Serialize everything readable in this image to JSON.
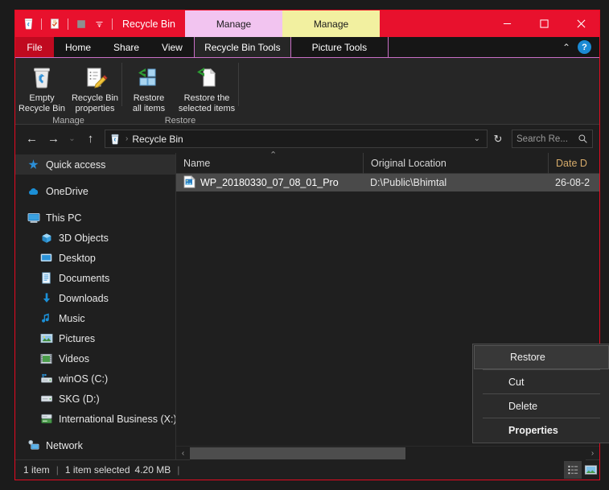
{
  "window": {
    "title": "Recycle Bin",
    "accent_color": "#e8112d",
    "quick_access": [
      {
        "name": "recycle-bin-icon",
        "label": "Recycle Bin"
      },
      {
        "name": "properties-icon",
        "label": "Properties"
      },
      {
        "name": "view-icon",
        "label": "View"
      },
      {
        "name": "customize-dropdown-icon",
        "label": "Customize Quick Access Toolbar"
      }
    ],
    "contextual_tabs": [
      {
        "label": "Manage",
        "group": "Recycle Bin Tools",
        "color": "#f2c4f0"
      },
      {
        "label": "Manage",
        "group": "Picture Tools",
        "color": "#f2f0a0"
      }
    ],
    "caption": {
      "minimize": "—",
      "maximize": "□",
      "close": "✕"
    }
  },
  "ribbon": {
    "tabs": [
      {
        "label": "File",
        "selected": false
      },
      {
        "label": "Home",
        "selected": false
      },
      {
        "label": "Share",
        "selected": false
      },
      {
        "label": "View",
        "selected": false
      },
      {
        "label": "Recycle Bin Tools",
        "selected": true
      },
      {
        "label": "Picture Tools",
        "selected": false
      }
    ],
    "collapse_label": "⌃",
    "help_label": "?",
    "groups": [
      {
        "title": "Manage",
        "buttons": [
          {
            "label_line1": "Empty",
            "label_line2": "Recycle Bin",
            "icon": "empty-recycle-bin-icon"
          },
          {
            "label_line1": "Recycle Bin",
            "label_line2": "properties",
            "icon": "recycle-bin-properties-icon"
          }
        ]
      },
      {
        "title": "Restore",
        "buttons": [
          {
            "label_line1": "Restore",
            "label_line2": "all items",
            "icon": "restore-all-items-icon"
          },
          {
            "label_line1": "Restore the",
            "label_line2": "selected items",
            "icon": "restore-selected-items-icon"
          }
        ]
      }
    ]
  },
  "address_bar": {
    "back": "←",
    "forward": "→",
    "recent": "⌄",
    "up": "↑",
    "crumb_icon": "recycle-bin-icon",
    "path": "Recycle Bin",
    "separator": "›",
    "dropdown": "⌄",
    "refresh": "↻",
    "search_placeholder": "Search Re...",
    "search_value": ""
  },
  "sidebar": {
    "items": [
      {
        "label": "Quick access",
        "icon": "star-icon",
        "indent": false,
        "selected": true
      },
      {
        "gap": true
      },
      {
        "label": "OneDrive",
        "icon": "cloud-icon",
        "indent": false,
        "selected": false
      },
      {
        "gap": true
      },
      {
        "label": "This PC",
        "icon": "monitor-icon",
        "indent": false,
        "selected": false
      },
      {
        "label": "3D Objects",
        "icon": "cube-icon",
        "indent": true,
        "selected": false
      },
      {
        "label": "Desktop",
        "icon": "desktop-icon",
        "indent": true,
        "selected": false
      },
      {
        "label": "Documents",
        "icon": "documents-icon",
        "indent": true,
        "selected": false
      },
      {
        "label": "Downloads",
        "icon": "download-arrow-icon",
        "indent": true,
        "selected": false
      },
      {
        "label": "Music",
        "icon": "music-note-icon",
        "indent": true,
        "selected": false
      },
      {
        "label": "Pictures",
        "icon": "picture-icon",
        "indent": true,
        "selected": false
      },
      {
        "label": "Videos",
        "icon": "video-icon",
        "indent": true,
        "selected": false
      },
      {
        "label": "winOS (C:)",
        "icon": "os-drive-icon",
        "indent": true,
        "selected": false
      },
      {
        "label": "SKG (D:)",
        "icon": "drive-icon",
        "indent": true,
        "selected": false
      },
      {
        "label": "International Business (X:)",
        "icon": "network-drive-icon",
        "indent": true,
        "selected": false
      },
      {
        "gap": true
      },
      {
        "label": "Network",
        "icon": "network-icon",
        "indent": false,
        "selected": false
      }
    ]
  },
  "file_list": {
    "columns": [
      {
        "label": "Name",
        "sorted": true
      },
      {
        "label": "Original Location",
        "sorted": false
      },
      {
        "label": "Date D",
        "sorted": false
      }
    ],
    "rows": [
      {
        "name": "WP_20180330_07_08_01_Pro",
        "original_location": "D:\\Public\\Bhimtal",
        "date_deleted": "26-08-2",
        "icon": "image-file-icon",
        "selected": true
      }
    ]
  },
  "context_menu": {
    "items": [
      {
        "label": "Restore",
        "bold": false,
        "highlighted": true
      },
      {
        "label": "Cut",
        "bold": false,
        "highlighted": false
      },
      {
        "label": "Delete",
        "bold": false,
        "highlighted": false
      },
      {
        "label": "Properties",
        "bold": true,
        "highlighted": false
      }
    ]
  },
  "status_bar": {
    "item_count": "1 item",
    "selection": "1 item selected",
    "size": "4.20 MB",
    "views": [
      {
        "name": "details-view-button",
        "active": true
      },
      {
        "name": "large-icons-view-button",
        "active": false
      }
    ]
  },
  "scrollbar": {
    "left_arrow": "‹",
    "right_arrow": "›"
  }
}
